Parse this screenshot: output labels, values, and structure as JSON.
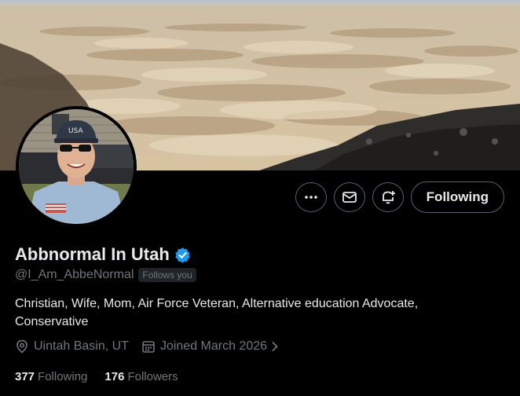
{
  "profile": {
    "display_name": "Abbnormal In Utah",
    "handle": "@I_Am_AbbeNormal",
    "follows_you": "Follows you",
    "bio": "Christian, Wife, Mom, Air Force Veteran, Alternative education Advocate, Conservative",
    "location": "Uintah Basin, UT",
    "joined": "Joined March 2026",
    "following_count": "377",
    "following_label": "Following",
    "followers_count": "176",
    "followers_label": "Followers",
    "verified": true
  },
  "actions": {
    "more_icon": "more-dots-icon",
    "message_icon": "envelope-icon",
    "notify_icon": "bell-plus-icon",
    "follow_label": "Following"
  },
  "colors": {
    "background": "#000000",
    "text_primary": "#e7e9ea",
    "text_secondary": "#71767b",
    "border": "#536471",
    "verified_blue": "#1d9bf0"
  }
}
